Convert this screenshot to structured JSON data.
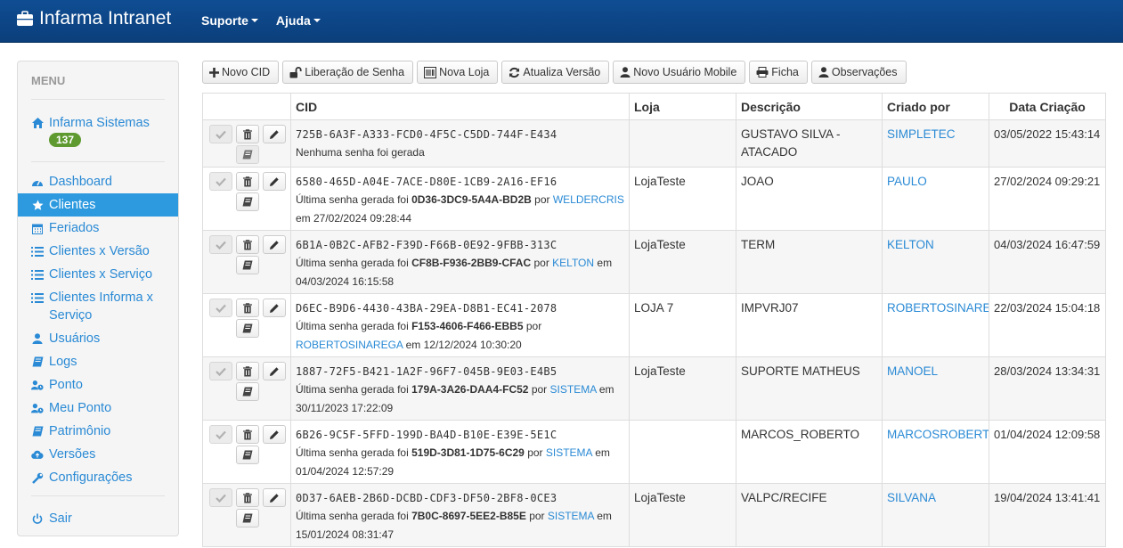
{
  "app": {
    "title": "Infarma Intranet"
  },
  "nav": {
    "items": [
      "Suporte",
      "Ajuda"
    ]
  },
  "sidebar": {
    "menu_label": "MENU",
    "badge": "137",
    "items": [
      {
        "label": "Infarma Sistemas",
        "icon": "home-icon"
      },
      {
        "label": "Dashboard",
        "icon": "dashboard-icon"
      },
      {
        "label": "Clientes",
        "icon": "star-icon",
        "active": true
      },
      {
        "label": "Feriados",
        "icon": "calendar-icon"
      },
      {
        "label": "Clientes x Versão",
        "icon": "list-icon"
      },
      {
        "label": "Clientes x Serviço",
        "icon": "list-icon"
      },
      {
        "label": "Clientes Informa x Serviço",
        "icon": "list-icon"
      },
      {
        "label": "Usuários",
        "icon": "user-icon"
      },
      {
        "label": "Logs",
        "icon": "book-icon"
      },
      {
        "label": "Ponto",
        "icon": "user-clock-icon"
      },
      {
        "label": "Meu Ponto",
        "icon": "user-clock-icon"
      },
      {
        "label": "Patrimônio",
        "icon": "book-icon"
      },
      {
        "label": "Versões",
        "icon": "cloud-upload-icon"
      },
      {
        "label": "Configurações",
        "icon": "wrench-icon"
      },
      {
        "label": "Sair",
        "icon": "power-icon"
      }
    ]
  },
  "toolbar": {
    "novo_cid": "Novo CID",
    "liberacao": "Liberação de Senha",
    "nova_loja": "Nova Loja",
    "atualiza": "Atualiza Versão",
    "novo_usuario": "Novo Usuário Mobile",
    "ficha": "Ficha",
    "observacoes": "Observações"
  },
  "table": {
    "headers": [
      "CID",
      "Loja",
      "Descrição",
      "Criado por",
      "Data Criação"
    ],
    "rows": [
      {
        "cid": "725B-6A3F-A333-FCD0-4F5C-C5DD-744F-E434",
        "senha_none": "Nenhuma senha foi gerada",
        "loja": "",
        "descricao": "GUSTAVO SILVA - ATACADO",
        "criado_por": "SIMPLETEC",
        "data": "03/05/2022 15:43:14"
      },
      {
        "cid": "6580-465D-A04E-7ACE-D80E-1CB9-2A16-EF16",
        "prefix": "Última senha gerada foi",
        "senha": "0D36-3DC9-5A4A-BD2B",
        "por": "por",
        "user": "WELDERCRIS",
        "em": "em 27/02/2024 09:28:44",
        "loja": "LojaTeste",
        "descricao": "JOAO",
        "criado_por": "PAULO",
        "data": "27/02/2024 09:29:21"
      },
      {
        "cid": "6B1A-0B2C-AFB2-F39D-F66B-0E92-9FBB-313C",
        "prefix": "Última senha gerada foi",
        "senha": "CF8B-F936-2BB9-CFAC",
        "por": "por",
        "user": "KELTON",
        "em": "em 04/03/2024 16:15:58",
        "loja": "LojaTeste",
        "descricao": "TERM",
        "criado_por": "KELTON",
        "data": "04/03/2024 16:47:59"
      },
      {
        "cid": "D6EC-B9D6-4430-43BA-29EA-D8B1-EC41-2078",
        "prefix": "Última senha gerada foi",
        "senha": "F153-4606-F466-EBB5",
        "por": "por",
        "user": "ROBERTOSINAREGA",
        "em": "em 12/12/2024 10:30:20",
        "loja": "LOJA 7",
        "descricao": "IMPVRJ07",
        "criado_por": "ROBERTOSINAREGA",
        "data": "22/03/2024 15:04:18"
      },
      {
        "cid": "1887-72F5-B421-1A2F-96F7-045B-9E03-E4B5",
        "prefix": "Última senha gerada foi",
        "senha": "179A-3A26-DAA4-FC52",
        "por": "por",
        "user": "SISTEMA",
        "em": "em 30/11/2023 17:22:09",
        "loja": "LojaTeste",
        "descricao": "SUPORTE MATHEUS",
        "criado_por": "MANOEL",
        "data": "28/03/2024 13:34:31"
      },
      {
        "cid": "6B26-9C5F-5FFD-199D-BA4D-B10E-E39E-5E1C",
        "prefix": "Última senha gerada foi",
        "senha": "519D-3D81-1D75-6C29",
        "por": "por",
        "user": "SISTEMA",
        "em": "em 01/04/2024 12:57:29",
        "loja": "",
        "descricao": "MARCOS_ROBERTO",
        "criado_por": "MARCOSROBERTO",
        "data": "01/04/2024 12:09:58"
      },
      {
        "cid": "0D37-6AEB-2B6D-DCBD-CDF3-DF50-2BF8-0CE3",
        "prefix": "Última senha gerada foi",
        "senha": "7B0C-8697-5EE2-B85E",
        "por": "por",
        "user": "SISTEMA",
        "em": "em 15/01/2024 08:31:47",
        "loja": "LojaTeste",
        "descricao": "VALPC/RECIFE",
        "criado_por": "SILVANA",
        "data": "19/04/2024 13:41:41"
      }
    ]
  },
  "colors": {
    "navbar": "#0f4d93",
    "link": "#2a8ad5",
    "active": "#2d9ae0",
    "badge": "#5f9a30"
  }
}
